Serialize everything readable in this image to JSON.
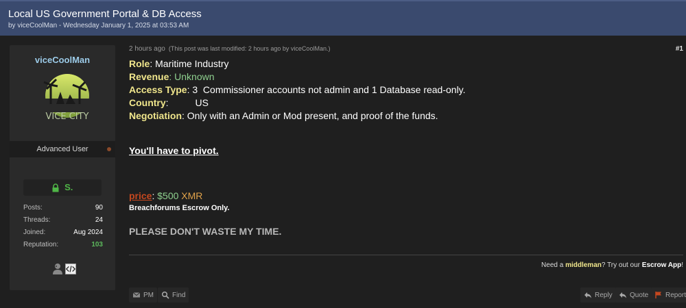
{
  "thread": {
    "title": "Local US Government Portal & DB Access",
    "meta": "by viceCoolMan - Wednesday January 1, 2025 at 03:53 AM"
  },
  "user": {
    "name": "viceCoolMan",
    "avatar_text": "VICE CITY",
    "rank": "Advanced User",
    "badge": "S.",
    "stats": [
      {
        "label": "Posts:",
        "value": "90"
      },
      {
        "label": "Threads:",
        "value": "24"
      },
      {
        "label": "Joined:",
        "value": "Aug 2024"
      },
      {
        "label": "Reputation:",
        "value": "103"
      }
    ]
  },
  "post": {
    "time": "2 hours ago",
    "modified": "(This post was last modified: 2 hours ago by viceCoolMan.)",
    "number": "#1",
    "fields": [
      {
        "key": "Role",
        "sep": ": ",
        "value": "Maritime Industry"
      },
      {
        "key": "Revenue",
        "sep": ": ",
        "value": "Unknown"
      },
      {
        "key": "Access Type",
        "sep": ": ",
        "value": "3  Commissioner accounts not admin and 1 Database read-only."
      },
      {
        "key": "Country",
        "sep": ":          ",
        "value": "US"
      },
      {
        "key": "Negotiation",
        "sep": ": ",
        "value": "Only with an Admin or Mod present, and proof of the funds."
      }
    ],
    "pivot": "You'll have to pivot.",
    "price_key": "price",
    "price_sep": ": ",
    "price_value": "$500",
    "price_currency": " XMR",
    "escrow": "Breachforums Escrow Only.",
    "warning": "PLEASE DON'T WASTE MY TIME."
  },
  "signature": {
    "pre": "Need a ",
    "middleman": "middleman",
    "mid": "? Try out our ",
    "app": "Escrow App",
    "post": "!"
  },
  "buttons": {
    "pm": "PM",
    "find": "Find",
    "reply": "Reply",
    "quote": "Quote",
    "report": "Report"
  },
  "colors": {
    "header_bg": "#3a4a6e",
    "key_yellow": "#f0e68c",
    "price_red": "#c4471f",
    "value_green": "#8fd18f",
    "reputation_green": "#5cb85c"
  }
}
